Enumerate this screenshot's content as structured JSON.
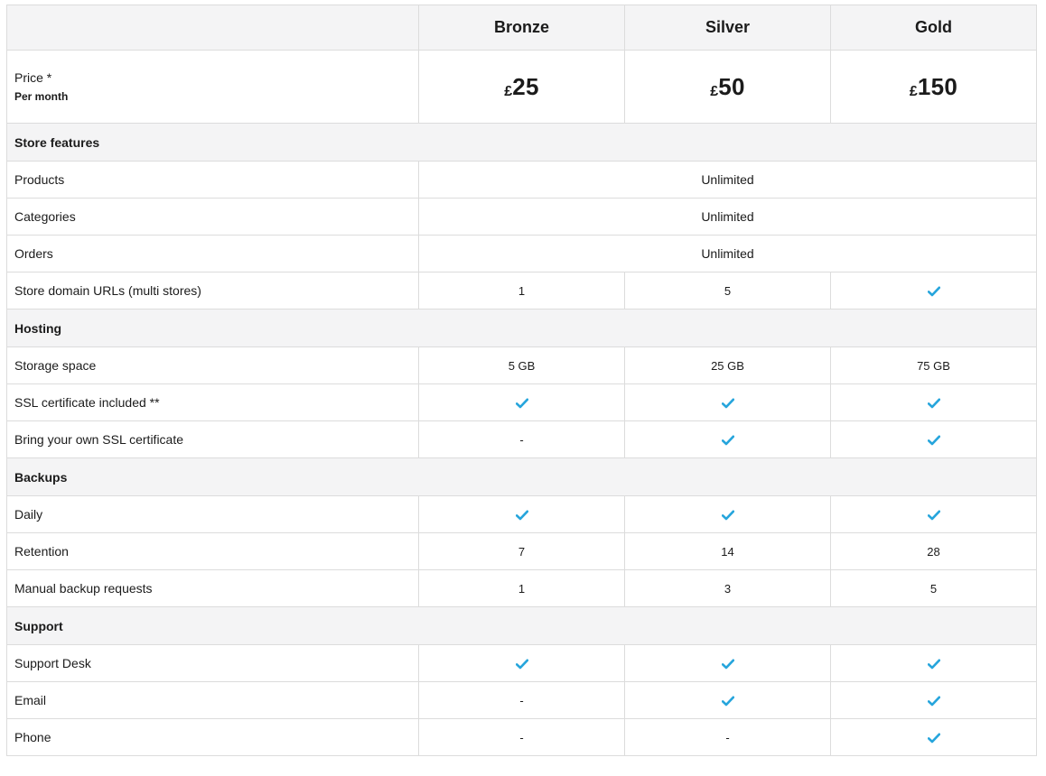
{
  "colors": {
    "check": "#26a5dc",
    "header_bg": "#f4f4f5",
    "border": "#dcdcdc"
  },
  "plans": [
    "Bronze",
    "Silver",
    "Gold"
  ],
  "price": {
    "label": "Price *",
    "sublabel": "Per month",
    "currency": "£",
    "amounts": [
      "25",
      "50",
      "150"
    ]
  },
  "sections": [
    {
      "title": "Store features",
      "rows": [
        {
          "label": "Products",
          "span": "Unlimited"
        },
        {
          "label": "Categories",
          "span": "Unlimited"
        },
        {
          "label": "Orders",
          "span": "Unlimited"
        },
        {
          "label": "Store domain URLs (multi stores)",
          "values": [
            "1",
            "5",
            "check-icon"
          ]
        }
      ]
    },
    {
      "title": "Hosting",
      "rows": [
        {
          "label": "Storage space",
          "values": [
            "5 GB",
            "25 GB",
            "75 GB"
          ]
        },
        {
          "label": "SSL certificate included **",
          "values": [
            "check-icon",
            "check-icon",
            "check-icon"
          ]
        },
        {
          "label": "Bring your own SSL certificate",
          "values": [
            "-",
            "check-icon",
            "check-icon"
          ]
        }
      ]
    },
    {
      "title": "Backups",
      "rows": [
        {
          "label": "Daily",
          "values": [
            "check-icon",
            "check-icon",
            "check-icon"
          ]
        },
        {
          "label": "Retention",
          "values": [
            "7",
            "14",
            "28"
          ]
        },
        {
          "label": "Manual backup requests",
          "values": [
            "1",
            "3",
            "5"
          ]
        }
      ]
    },
    {
      "title": "Support",
      "rows": [
        {
          "label": "Support Desk",
          "values": [
            "check-icon",
            "check-icon",
            "check-icon"
          ]
        },
        {
          "label": "Email",
          "values": [
            "-",
            "check-icon",
            "check-icon"
          ]
        },
        {
          "label": "Phone",
          "values": [
            "-",
            "-",
            "check-icon"
          ]
        }
      ]
    }
  ]
}
